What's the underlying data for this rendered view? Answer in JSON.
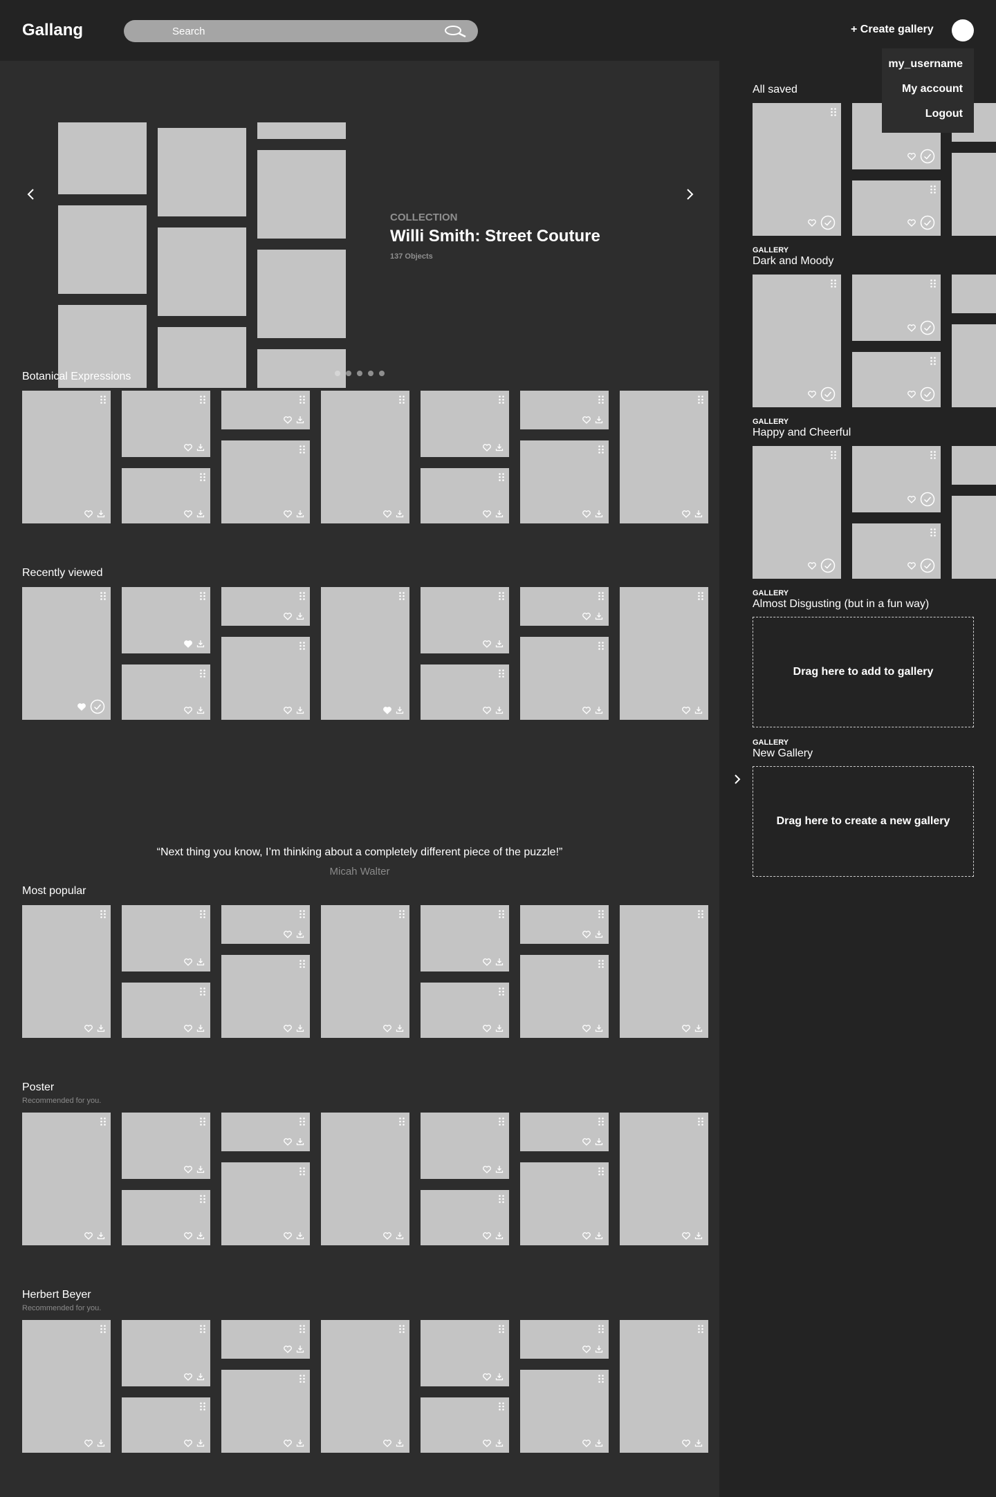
{
  "header": {
    "logo": "Gallang",
    "search_placeholder": "Search",
    "create_gallery": "+ Create gallery"
  },
  "user_menu": {
    "username": "my_username",
    "account": "My account",
    "logout": "Logout"
  },
  "hero": {
    "kicker": "COLLECTION",
    "title": "Willi Smith: Street Couture",
    "count": "137 Objects",
    "slides": 5,
    "active_slide": 1
  },
  "sections": [
    {
      "title": "Botanical Expressions",
      "subtitle": ""
    },
    {
      "title": "Recently viewed",
      "subtitle": ""
    },
    {
      "title": "Most popular",
      "subtitle": ""
    },
    {
      "title": "Poster",
      "subtitle": "Recommended for you."
    },
    {
      "title": "Herbert Beyer",
      "subtitle": "Recommended for you."
    }
  ],
  "quote": {
    "text": "“Next thing you know, I’m thinking about a completely different piece of the puzzle!”",
    "author": "Micah Walter"
  },
  "sidebar": {
    "all_saved": "All saved",
    "galleries": [
      {
        "kicker": "GALLERY",
        "title": "Dark and Moody"
      },
      {
        "kicker": "GALLERY",
        "title": "Happy and Cheerful"
      },
      {
        "kicker": "GALLERY",
        "title": "Almost Disgusting (but in a fun way)",
        "dropzone": "Drag here to add to gallery"
      },
      {
        "kicker": "GALLERY",
        "title": "New Gallery",
        "dropzone": "Drag here to create a new gallery"
      }
    ]
  },
  "colors": {
    "tile": "#c4c4c4",
    "main_bg": "#2d2d2d",
    "sidebar_bg": "#232323"
  }
}
